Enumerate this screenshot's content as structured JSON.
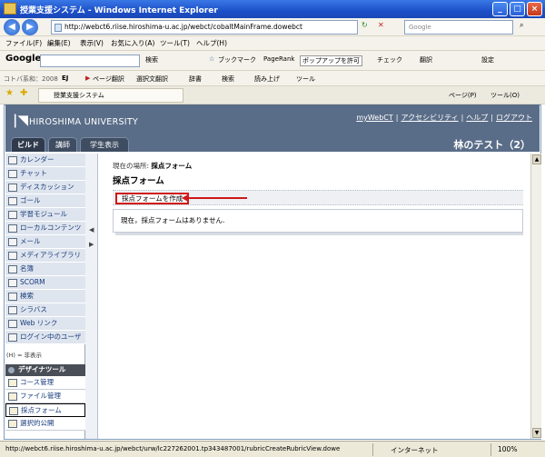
{
  "window": {
    "title": "授業支援システム - Windows Internet Explorer",
    "min": "_",
    "max": "□",
    "close": "×"
  },
  "address": {
    "url": "http://webct6.riise.hiroshima-u.ac.jp/webct/cobaltMainFrame.dowebct",
    "search_placeholder": "Google",
    "go": "↻",
    "stop": "✕"
  },
  "menu": {
    "file": "ファイル(F)",
    "edit": "編集(E)",
    "view": "表示(V)",
    "favorites": "お気に入り(A)",
    "tools": "ツール(T)",
    "help": "ヘルプ(H)"
  },
  "googlebar": {
    "logo": "Google",
    "search": "検索",
    "bookmarks": "ブックマーク",
    "pagerank": "PageRank",
    "popup": "ポップアップを許可",
    "check": "チェック",
    "translate": "翻訳",
    "settings": "設定"
  },
  "linksbar": {
    "dict": "コトバ系和：2008",
    "ej": "EJ",
    "page_translate": "ページ翻訳",
    "sel_translate": "選択文翻訳",
    "jisho": "辞書",
    "search": "検索",
    "readup": "読み上げ",
    "tools": "ツール"
  },
  "favbar": {
    "tab_title": "授業支援システム",
    "page": "ページ(P)",
    "tools": "ツール(O)"
  },
  "header": {
    "university": "HIROSHIMA UNIVERSITY",
    "links": [
      "myWebCT",
      "アクセシビリティ",
      "ヘルプ",
      "ログアウト"
    ],
    "username": "林のテスト（2）",
    "tabs": [
      "ビルド",
      "講師",
      "学生表示"
    ]
  },
  "nav": {
    "items": [
      "カレンダー",
      "チャット",
      "ディスカッション",
      "ゴール",
      "学習モジュール",
      "ローカルコンテンツ",
      "メール",
      "メディアライブラリ",
      "名簿",
      "SCORM",
      "検索",
      "シラバス",
      "Web リンク",
      "ログイン中のユーザ"
    ],
    "hidden_note": "(H) = 非表示",
    "design_title": "デザイナツール",
    "design_items": [
      "コース管理",
      "ファイル管理",
      "採点フォーム",
      "選択的公開"
    ]
  },
  "main": {
    "breadcrumb_label": "現在の場所:",
    "breadcrumb_current": "採点フォーム",
    "title": "採点フォーム",
    "create_button": "採点フォームを作成",
    "empty_message": "現在，採点フォームはありません."
  },
  "status": {
    "url": "http://webct6.riise.hiroshima-u.ac.jp/webct/urw/lc227262001.tp343487001/rubricCreateRubricView.dowe",
    "zone": "インターネット",
    "zoom": "100%"
  },
  "colors": {
    "header_bg": "#5a6d88",
    "highlight": "#d01818",
    "nav_bg": "#dfe5ee"
  }
}
